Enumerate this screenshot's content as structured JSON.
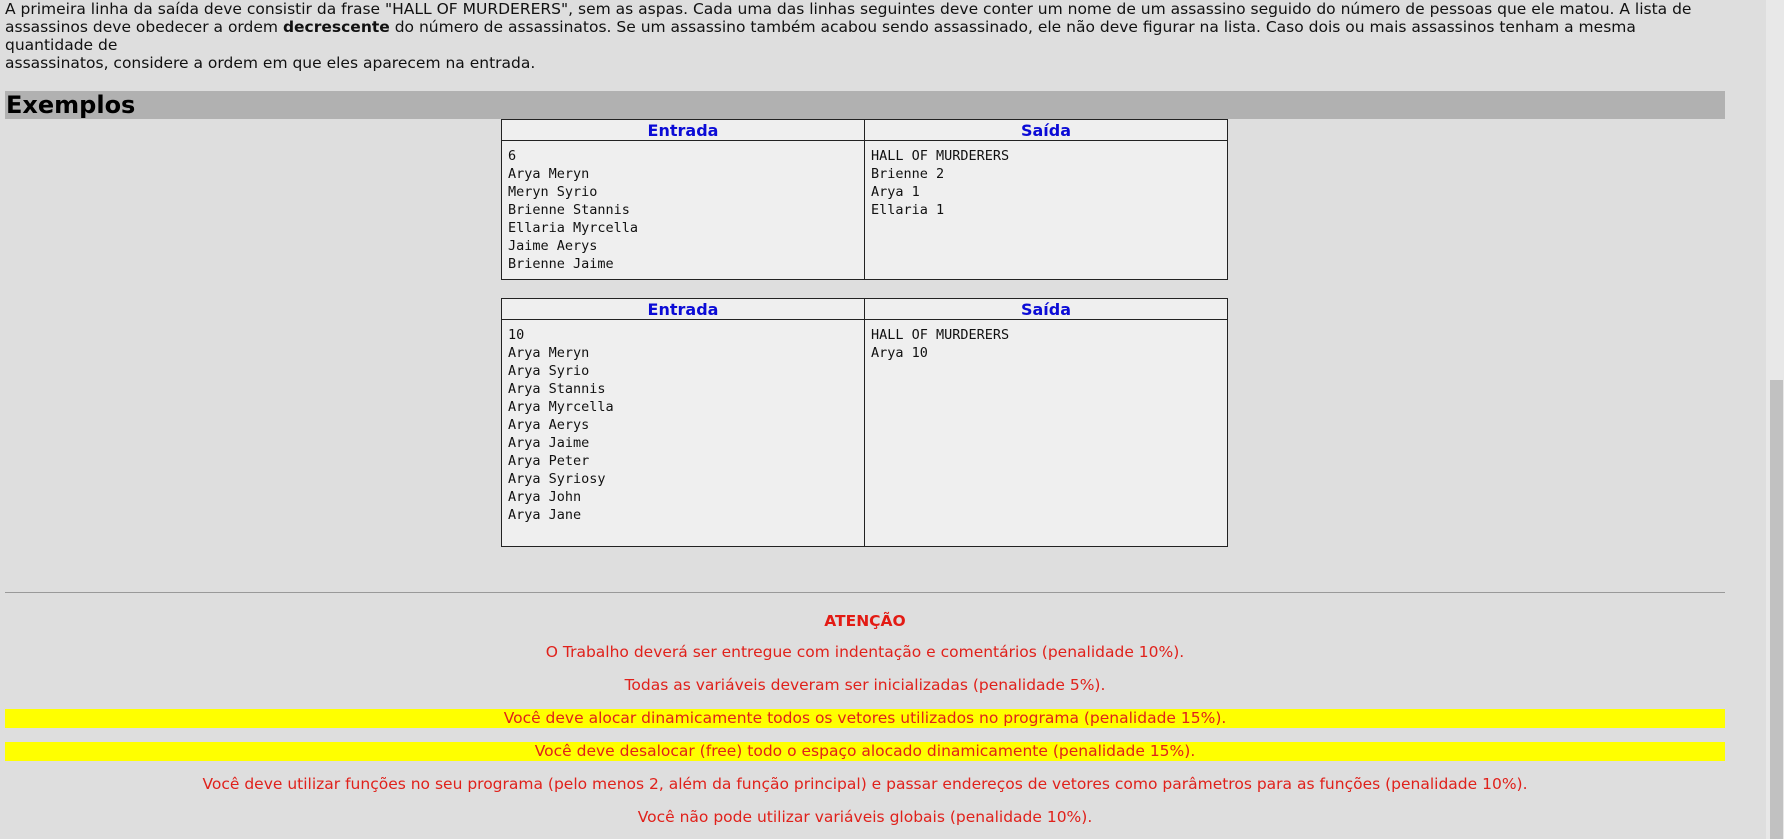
{
  "intro": {
    "line1": "A primeira linha da saída deve consistir da frase \"HALL OF MURDERERS\", sem as aspas. Cada uma das linhas seguintes deve conter um nome de um assassino seguido do número de pessoas que ele matou. A lista de",
    "line2_pre": "assassinos deve obedecer a ordem ",
    "line2_bold": "decrescente",
    "line2_post": " do número de assassinatos. Se um assassino também acabou sendo assassinado, ele não deve figurar na lista. Caso dois ou mais assassinos tenham a mesma quantidade de",
    "line3": "assassinatos, considere a ordem em que eles aparecem na entrada."
  },
  "section": {
    "title": "Exemplos"
  },
  "examples": [
    {
      "input_header": "Entrada",
      "output_header": "Saída",
      "input": "6\nArya Meryn\nMeryn Syrio\nBrienne Stannis\nEllaria Myrcella\nJaime Aerys\nBrienne Jaime",
      "output": "HALL OF MURDERERS\nBrienne 2\nArya 1\nEllaria 1"
    },
    {
      "input_header": "Entrada",
      "output_header": "Saída",
      "input": "10\nArya Meryn\nArya Syrio\nArya Stannis\nArya Myrcella\nArya Aerys\nArya Jaime\nArya Peter\nArya Syriosy\nArya John\nArya Jane",
      "output": "HALL OF MURDERERS\nArya 10"
    }
  ],
  "notes": {
    "title": "ATENÇÃO",
    "items": [
      "O Trabalho deverá ser entregue com indentação e comentários (penalidade 10%).",
      "Todas as variáveis deveram ser inicializadas (penalidade 5%).",
      "Você deve alocar dinamicamente todos os vetores utilizados no programa (penalidade 15%).",
      "Você deve desalocar (free) todo o espaço alocado dinamicamente (penalidade 15%).",
      "Você deve utilizar funções no seu programa (pelo menos 2, além da função principal) e passar endereços de vetores como parâmetros para as funções (penalidade 10%).",
      "Você não pode utilizar variáveis globais (penalidade 10%)."
    ]
  },
  "colors": {
    "highlight": "#ffff00",
    "warning_text": "#e0211b",
    "table_header_text": "#0b0bd6",
    "section_bar": "#b1b1b1",
    "page_bg": "#dedede"
  }
}
